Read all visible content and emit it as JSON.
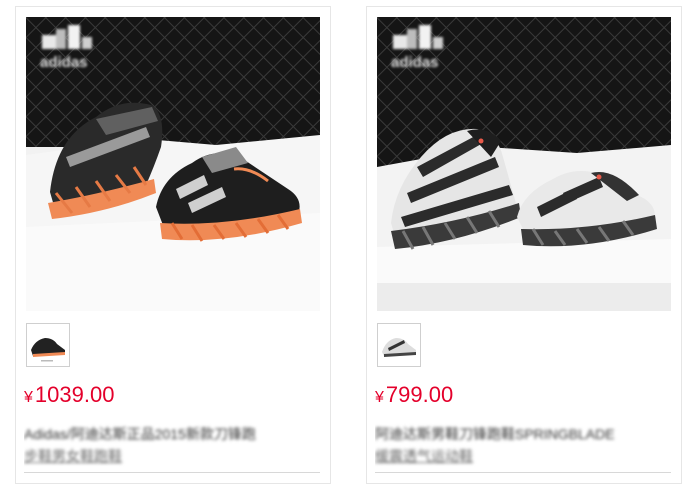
{
  "products": [
    {
      "brand": "adidas",
      "price_currency": "¥",
      "price_value": "1039.00",
      "title_line1": "Adidas/阿迪达斯正品2015新款刀锋跑",
      "title_line2": "步鞋男女鞋跑鞋",
      "colors": {
        "accent": "#e4002b",
        "sole": "#f08a55"
      }
    },
    {
      "brand": "adidas",
      "price_currency": "¥",
      "price_value": "799.00",
      "title_line1": "阿迪达斯男鞋刀锋跑鞋SPRINGBLADE",
      "title_line1_visible_tail": "DE",
      "title_line2": "缓震透气运动鞋",
      "colors": {
        "accent": "#e4002b",
        "sole": "#bbbbbb"
      }
    }
  ]
}
